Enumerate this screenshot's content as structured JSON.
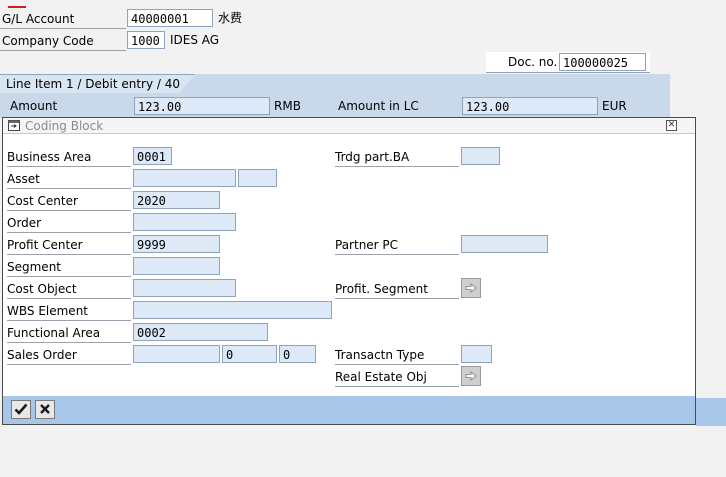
{
  "header": {
    "gl_account_label": "G/L Account",
    "gl_account_value": "40000001",
    "gl_account_desc": "水费",
    "company_code_label": "Company Code",
    "company_code_value": "1000",
    "company_code_desc": "IDES AG",
    "doc_no_label": "Doc. no.",
    "doc_no_value": "100000025"
  },
  "line_item": {
    "tab_label": "Line Item 1 / Debit entry / 40",
    "amount_label": "Amount",
    "amount_value": "123.00",
    "amount_currency": "RMB",
    "amount_lc_label": "Amount in LC",
    "amount_lc_value": "123.00",
    "amount_lc_currency": "EUR"
  },
  "dialog": {
    "title": "Coding Block",
    "title_icon": "window-icon",
    "close_icon": "close-icon",
    "fields": {
      "business_area": {
        "label": "Business Area",
        "value": "0001"
      },
      "asset": {
        "label": "Asset",
        "value": "",
        "sub_value": ""
      },
      "cost_center": {
        "label": "Cost Center",
        "value": "2020"
      },
      "order": {
        "label": "Order",
        "value": ""
      },
      "profit_center": {
        "label": "Profit Center",
        "value": "9999"
      },
      "segment": {
        "label": "Segment",
        "value": ""
      },
      "cost_object": {
        "label": "Cost Object",
        "value": ""
      },
      "wbs_element": {
        "label": "WBS Element",
        "value": ""
      },
      "functional_area": {
        "label": "Functional Area",
        "value": "0002"
      },
      "sales_order": {
        "label": "Sales Order",
        "value": "",
        "item": "0",
        "schedule": "0"
      },
      "trdg_part_ba": {
        "label": "Trdg part.BA",
        "value": ""
      },
      "partner_pc": {
        "label": "Partner PC",
        "value": ""
      },
      "profit_segment": {
        "label": "Profit. Segment",
        "icon": "arrow-right-icon"
      },
      "transactn_type": {
        "label": "Transactn Type",
        "value": ""
      },
      "real_estate_obj": {
        "label": "Real Estate Obj",
        "icon": "arrow-right-icon"
      }
    },
    "footer": {
      "confirm_icon": "checkmark-icon",
      "cancel_icon": "cancel-x-icon"
    }
  }
}
